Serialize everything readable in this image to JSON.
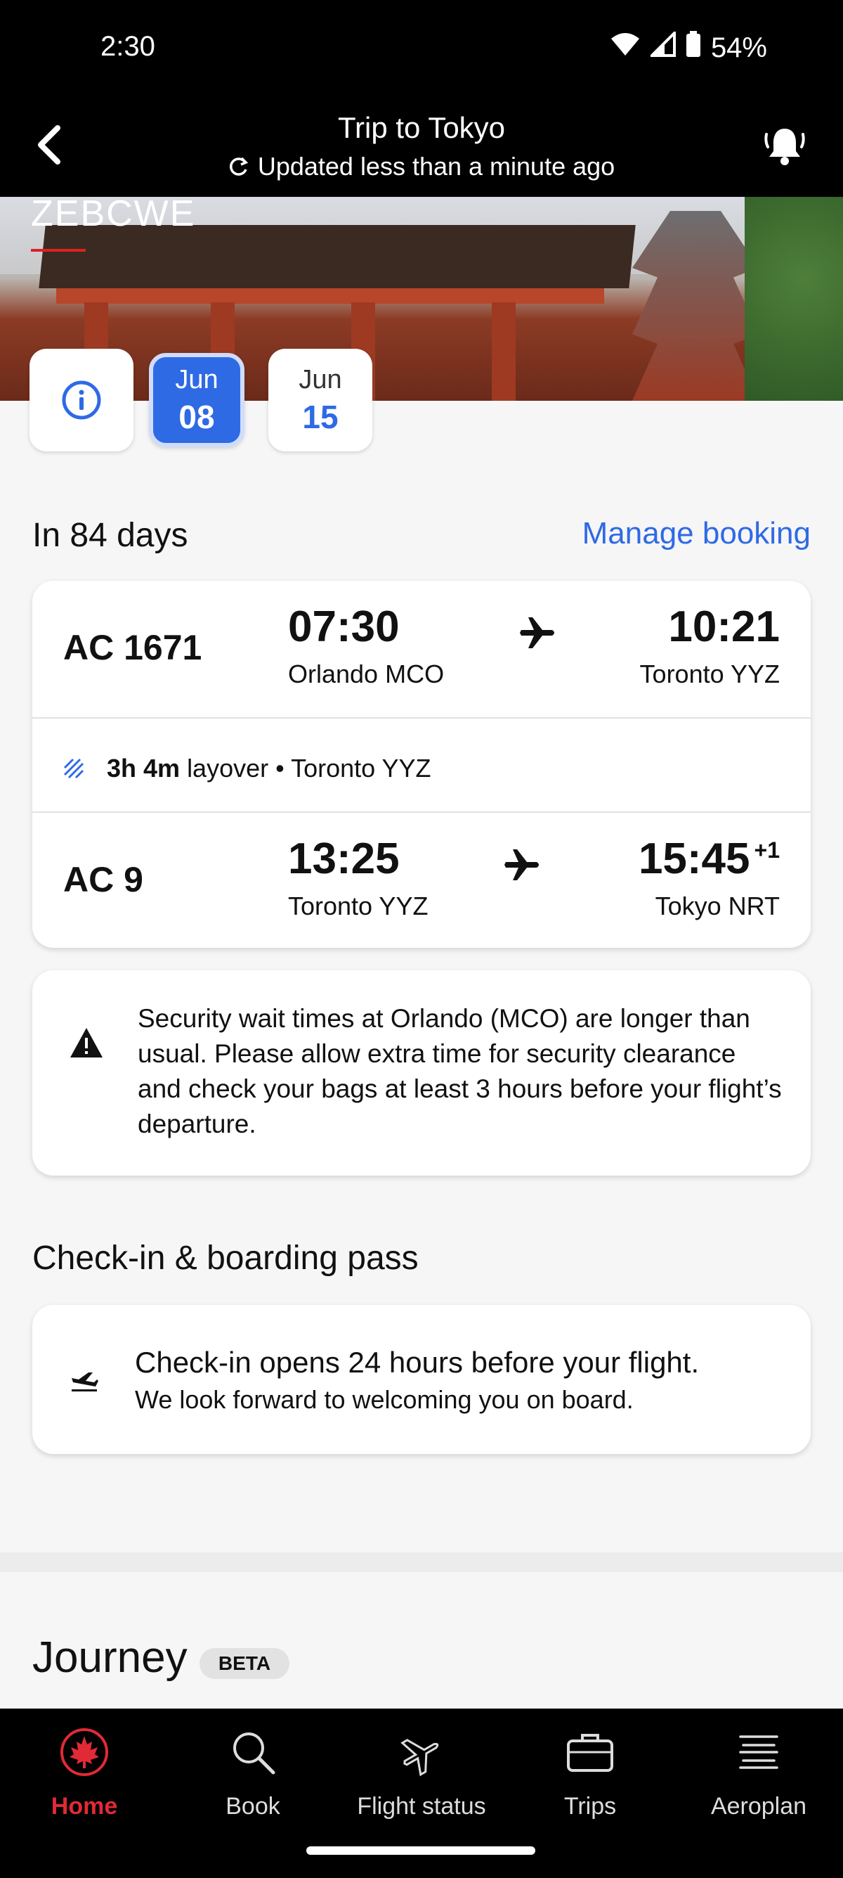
{
  "status_bar": {
    "time": "2:30",
    "battery": "54%"
  },
  "header": {
    "title": "Trip to Tokyo",
    "updated": "Updated less than a minute ago"
  },
  "hero": {
    "booking_code": "ZEBCWE"
  },
  "date_chips": [
    {
      "month": "Jun",
      "day": "08",
      "selected": true
    },
    {
      "month": "Jun",
      "day": "15",
      "selected": false
    }
  ],
  "countdown": "In 84 days",
  "manage_booking": "Manage booking",
  "flights": [
    {
      "number": "AC 1671",
      "dep_time": "07:30",
      "dep_city": "Orlando MCO",
      "arr_time": "10:21",
      "arr_city": "Toronto YYZ",
      "day_offset": ""
    },
    {
      "number": "AC 9",
      "dep_time": "13:25",
      "dep_city": "Toronto YYZ",
      "arr_time": "15:45",
      "arr_city": "Tokyo NRT",
      "day_offset": "+1"
    }
  ],
  "layover": {
    "duration": "3h 4m",
    "text": "layover • Toronto YYZ"
  },
  "alert": {
    "text": "Security wait times at Orlando (MCO) are longer than usual. Please allow extra time for security clearance and check your bags at least 3 hours before your flight’s departure."
  },
  "checkin": {
    "heading": "Check-in & boarding pass",
    "line1": "Check-in opens 24 hours before your flight.",
    "line2": "We look forward to welcoming you on board."
  },
  "journey": {
    "heading": "Journey",
    "badge": "BETA"
  },
  "nav": [
    {
      "label": "Home",
      "icon": "maple-leaf-icon",
      "active": true
    },
    {
      "label": "Book",
      "icon": "search-icon",
      "active": false
    },
    {
      "label": "Flight status",
      "icon": "plane-icon",
      "active": false
    },
    {
      "label": "Trips",
      "icon": "briefcase-icon",
      "active": false
    },
    {
      "label": "Aeroplan",
      "icon": "aeroplan-icon",
      "active": false
    }
  ],
  "colors": {
    "accent_blue": "#2f6ae5",
    "active_red": "#e12a36"
  }
}
